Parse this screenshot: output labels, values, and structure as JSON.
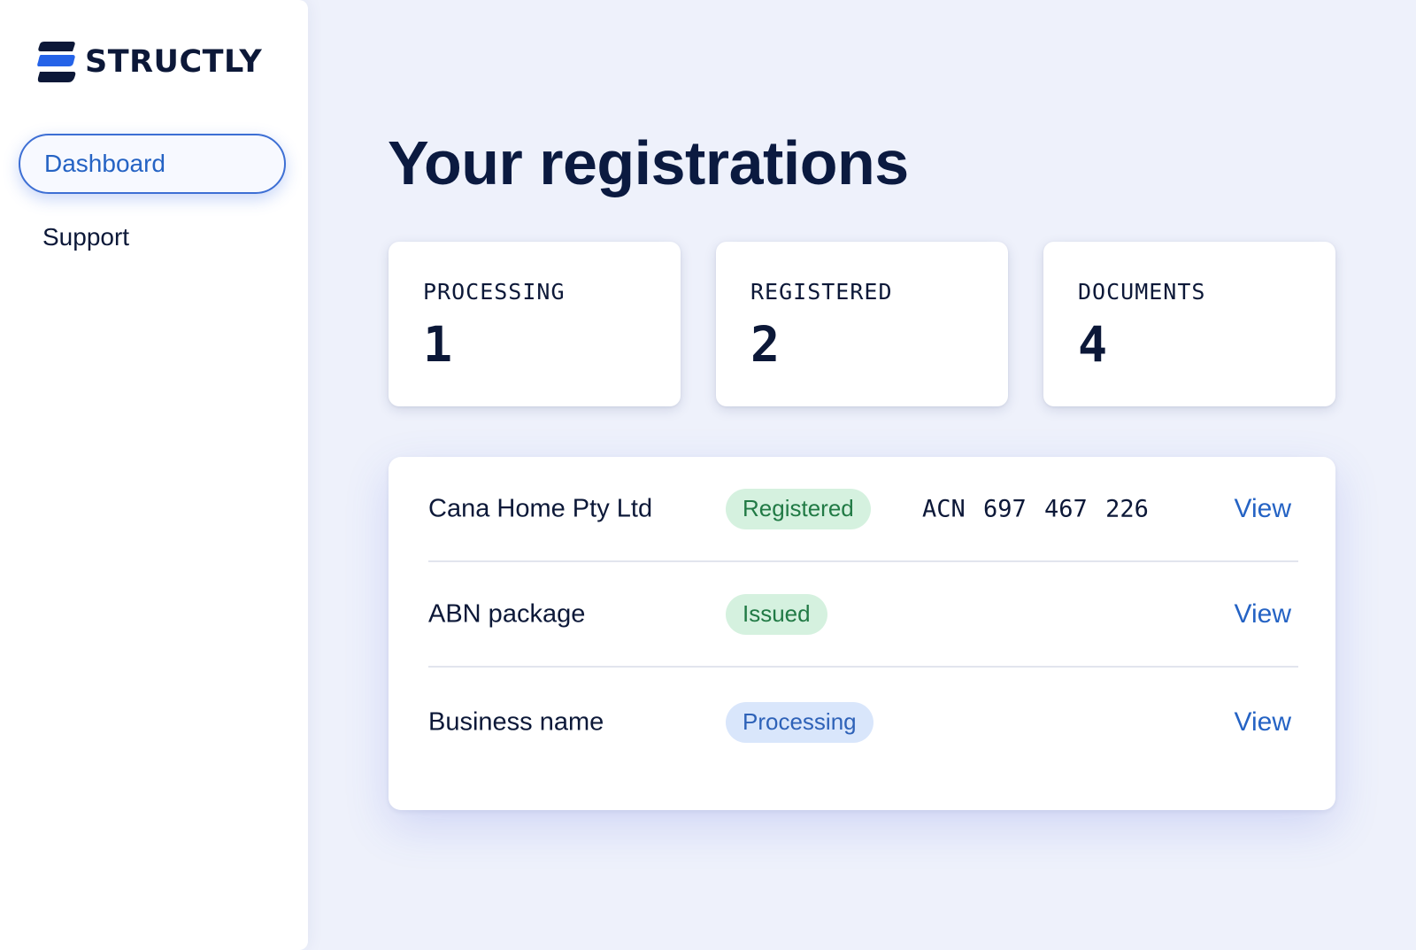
{
  "brand": {
    "name": "STRUCTLY",
    "logo_icon": "stacked-s-logo"
  },
  "sidebar": {
    "items": [
      {
        "label": "Dashboard",
        "active": true
      },
      {
        "label": "Support",
        "active": false
      }
    ]
  },
  "main": {
    "title": "Your registrations",
    "stats": [
      {
        "label": "PROCESSING",
        "value": "1"
      },
      {
        "label": "REGISTERED",
        "value": "2"
      },
      {
        "label": "DOCUMENTS",
        "value": "4"
      }
    ],
    "rows": [
      {
        "name": "Cana Home Pty Ltd",
        "status": "Registered",
        "status_color": "green",
        "reference": "ACN 697 467 226",
        "action": "View"
      },
      {
        "name": "ABN package",
        "status": "Issued",
        "status_color": "green",
        "reference": "",
        "action": "View"
      },
      {
        "name": "Business name",
        "status": "Processing",
        "status_color": "blue",
        "reference": "",
        "action": "View"
      }
    ]
  },
  "colors": {
    "accent": "#2563c4",
    "background": "#eef1fb",
    "badge_green_bg": "#d5f1df",
    "badge_blue_bg": "#d9e6fb"
  }
}
